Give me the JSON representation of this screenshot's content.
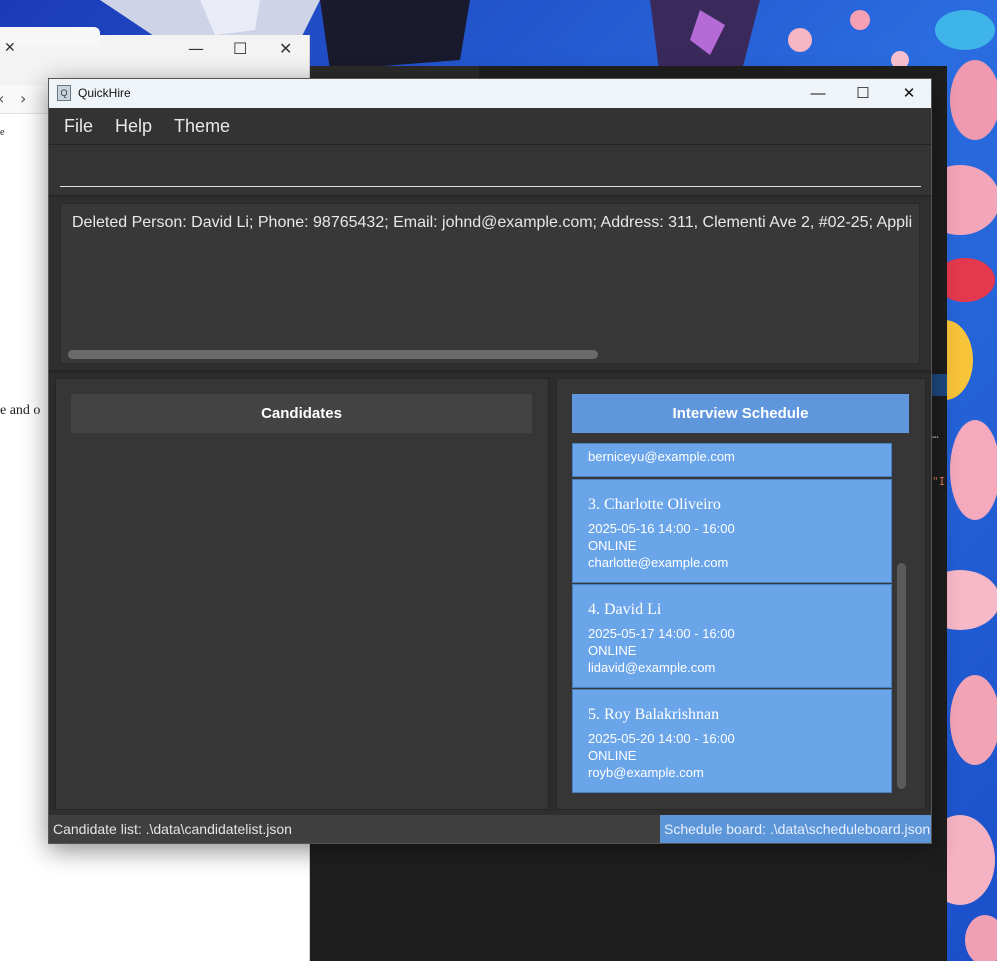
{
  "browser": {
    "minimize": "—",
    "maximize": "☐",
    "close": "✕",
    "back": "‹",
    "forward": "›",
    "close_tab": "✕",
    "fragment_1": "e",
    "fragment_2": "e and o"
  },
  "editor": {
    "fragment_1": "…",
    "fragment_2": "\"I"
  },
  "app": {
    "title": "QuickHire",
    "icon": "quickhire-app-icon",
    "window_controls": {
      "minimize": "—",
      "maximize": "☐",
      "close": "✕"
    },
    "menu": [
      "File",
      "Help",
      "Theme"
    ],
    "command_input": {
      "value": "",
      "placeholder": ""
    },
    "result_message": "Deleted Person: David Li; Phone: 98765432; Email: johnd@example.com; Address: 311, Clementi Ave 2, #02-25; Appli",
    "candidates_panel": {
      "title": "Candidates",
      "items": []
    },
    "schedule_panel": {
      "title": "Interview Schedule",
      "partial_card_email": "berniceyu@example.com",
      "entries": [
        {
          "index_name": "3. Charlotte Oliveiro",
          "datetime": "2025-05-16  14:00 -  16:00",
          "mode": "ONLINE",
          "email": "charlotte@example.com"
        },
        {
          "index_name": "4. David Li",
          "datetime": "2025-05-17  14:00 -  16:00",
          "mode": "ONLINE",
          "email": "lidavid@example.com"
        },
        {
          "index_name": "5. Roy Balakrishnan",
          "datetime": "2025-05-20  14:00 -  16:00",
          "mode": "ONLINE",
          "email": "royb@example.com"
        }
      ]
    },
    "status": {
      "candidate_list": "Candidate list: .\\data\\candidatelist.json",
      "schedule_board": "Schedule board: .\\data\\scheduleboard.json"
    },
    "colors": {
      "accent": "#6aa5ea",
      "header_accent": "#5f96dc",
      "background": "#2f2f2f"
    }
  }
}
